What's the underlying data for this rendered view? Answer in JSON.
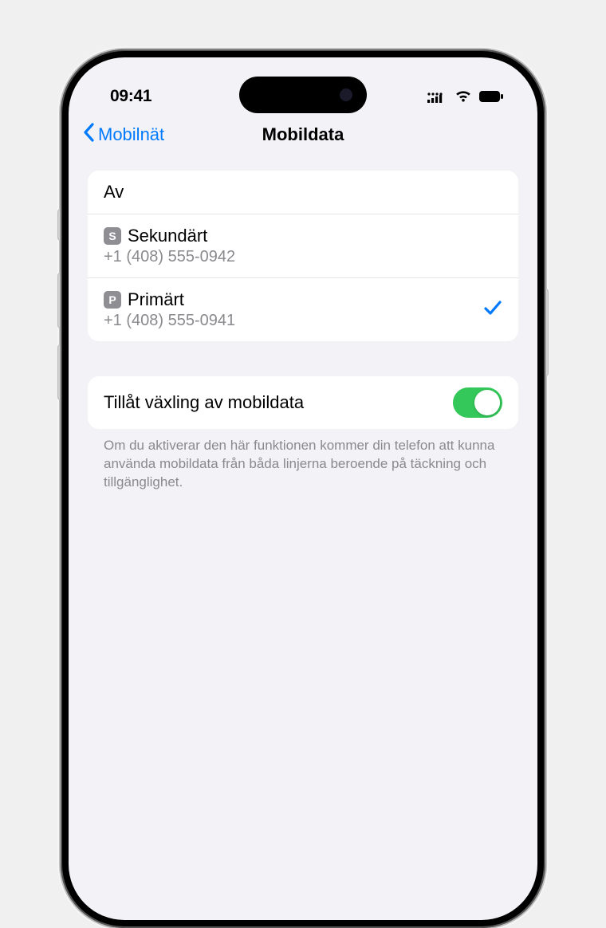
{
  "status": {
    "time": "09:41"
  },
  "nav": {
    "back_label": "Mobilnät",
    "title": "Mobildata"
  },
  "lines": {
    "off_label": "Av",
    "secondary_badge": "S",
    "secondary_name": "Sekundärt",
    "secondary_number": "+1 (408) 555-0942",
    "primary_badge": "P",
    "primary_name": "Primärt",
    "primary_number": "+1 (408) 555-0941"
  },
  "toggle": {
    "label": "Tillåt växling av mobildata",
    "on": true
  },
  "footer": {
    "text": "Om du aktiverar den här funktionen kommer din telefon att kunna använda mobildata från båda linjerna beroende på täckning och tillgänglighet."
  },
  "colors": {
    "accent": "#007aff",
    "switch_on": "#34c759"
  }
}
